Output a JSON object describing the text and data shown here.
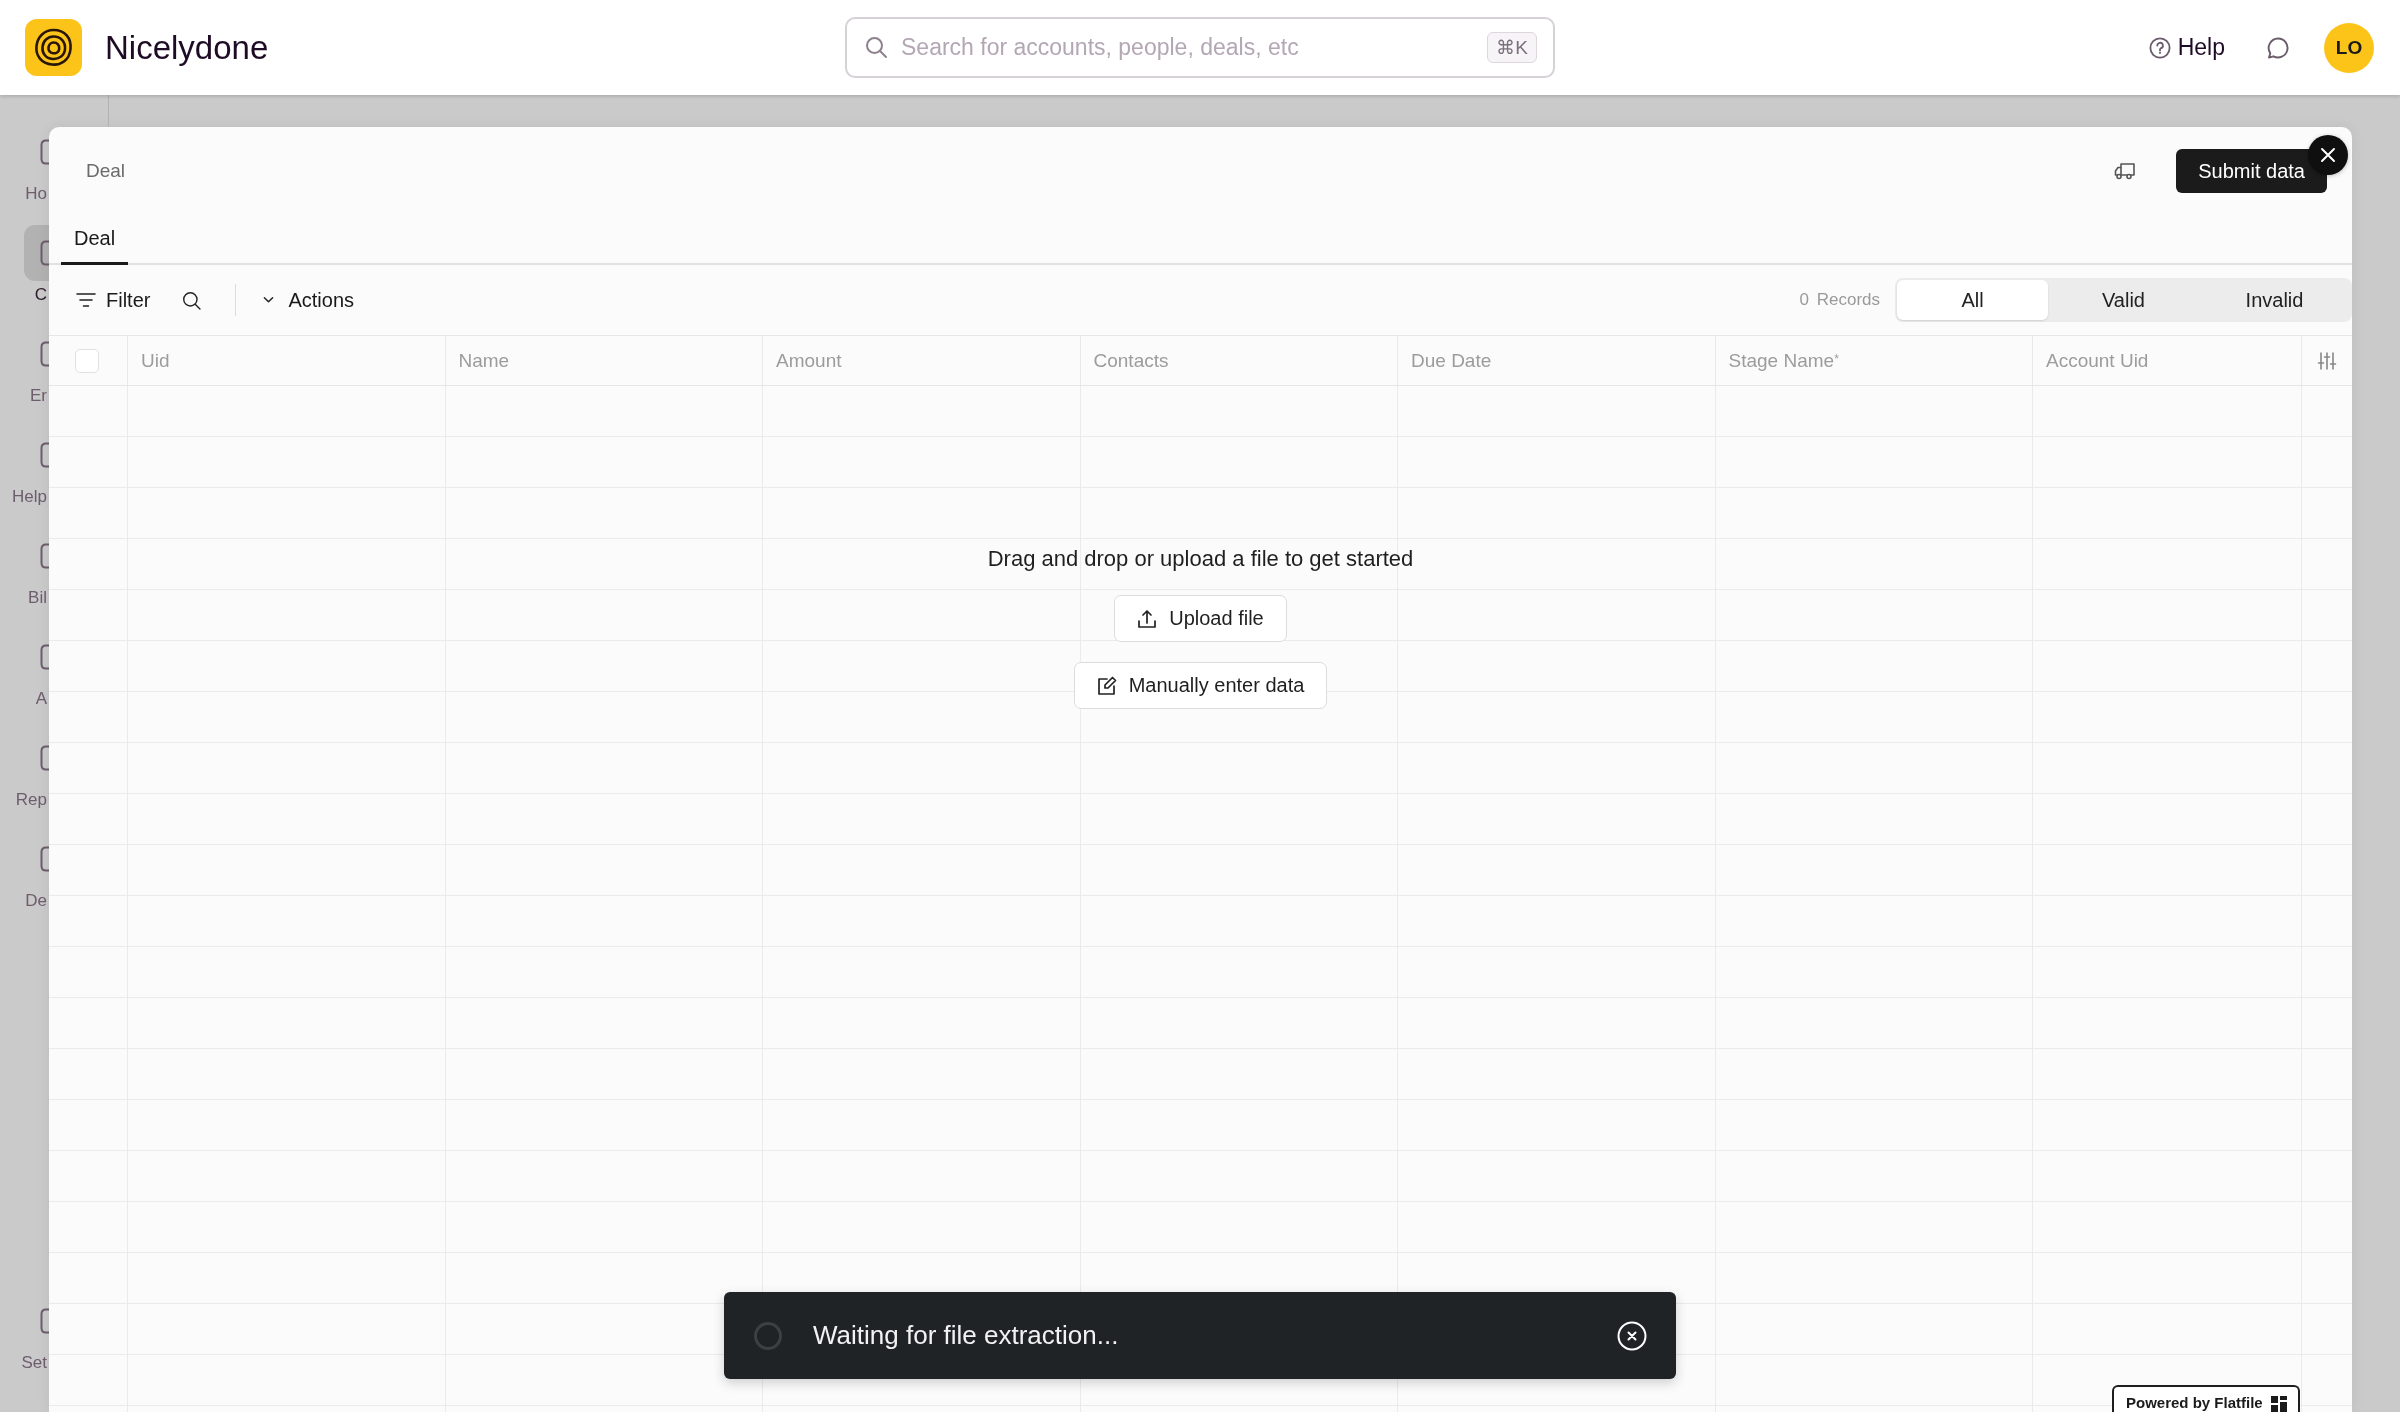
{
  "app": {
    "name": "Nicelydone"
  },
  "search": {
    "placeholder": "Search for accounts, people, deals, etc",
    "shortcut": "⌘K"
  },
  "header": {
    "help": "Help",
    "avatar": "LO"
  },
  "sidebar": {
    "items": [
      {
        "label": "Ho",
        "selected": false
      },
      {
        "label": "C",
        "selected": true
      },
      {
        "label": "Er",
        "selected": false
      },
      {
        "label": "Help",
        "selected": false
      },
      {
        "label": "Bil",
        "selected": false
      },
      {
        "label": "A",
        "selected": false
      },
      {
        "label": "Rep",
        "selected": false
      },
      {
        "label": "De",
        "selected": false
      }
    ],
    "bottom_items": [
      {
        "label": "Set",
        "selected": false
      }
    ]
  },
  "modal": {
    "title": "Deal",
    "submit": "Submit data",
    "tabs": [
      {
        "label": "Deal",
        "selected": true
      }
    ],
    "toolbar": {
      "filter": "Filter",
      "actions": "Actions",
      "records": "0 Records",
      "views": [
        {
          "label": "All",
          "selected": true
        },
        {
          "label": "Valid",
          "selected": false
        },
        {
          "label": "Invalid",
          "selected": false
        }
      ]
    },
    "table": {
      "select_all": {
        "checked": false
      },
      "columns": [
        "Uid",
        "Name",
        "Amount",
        "Contacts",
        "Due Date",
        "Stage Name$^{*}$",
        "Account Uid"
      ]
    },
    "empty_state": {
      "message": "Drag and drop or upload a file to get started",
      "buttons": [
        {
          "kind": "upload",
          "label": "Upload file"
        },
        {
          "kind": "manual",
          "label": "Manually enter data"
        }
      ]
    },
    "badge": "Powered by Flatfile"
  },
  "toast": {
    "message": "Waiting for file extraction..."
  }
}
